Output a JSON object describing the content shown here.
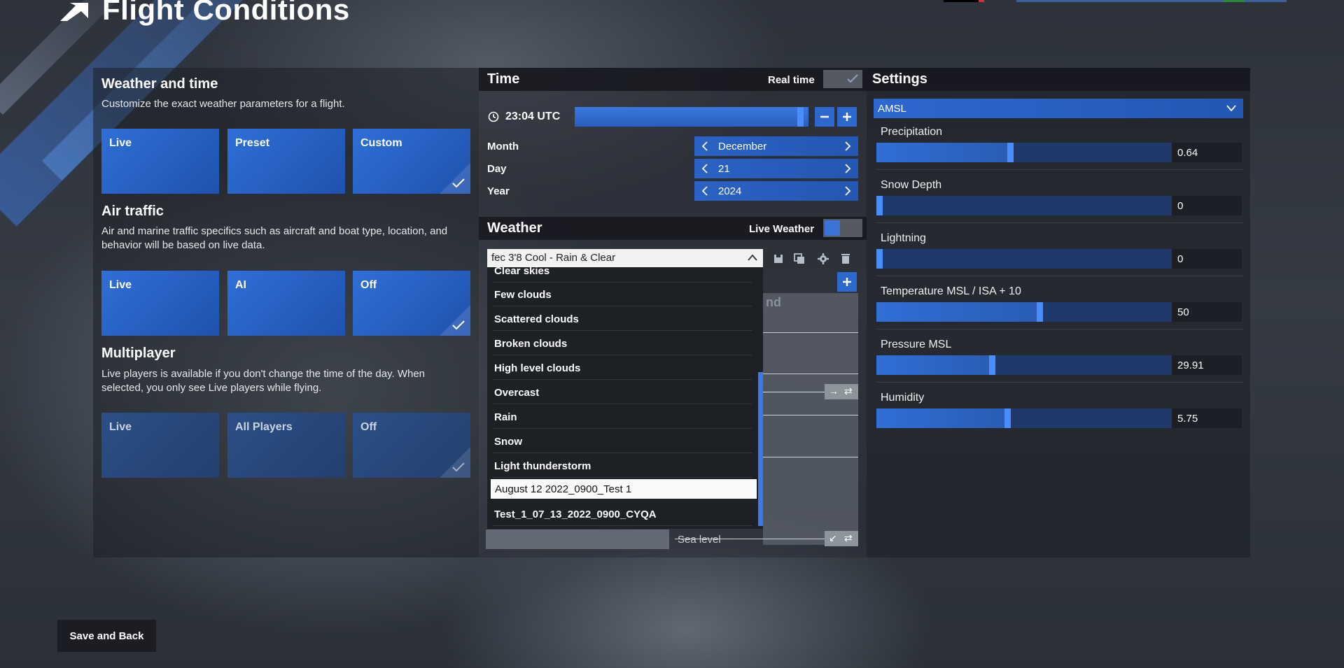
{
  "header": {
    "title": "Flight Conditions"
  },
  "weather_time": {
    "title": "Weather and time",
    "desc": "Customize the exact weather parameters for a flight.",
    "options": [
      {
        "label": "Live",
        "selected": false
      },
      {
        "label": "Preset",
        "selected": false
      },
      {
        "label": "Custom",
        "selected": true
      }
    ]
  },
  "air_traffic": {
    "title": "Air traffic",
    "desc": "Air and marine traffic specifics such as aircraft and boat type, location, and behavior will be based on live data.",
    "options": [
      {
        "label": "Live",
        "selected": false
      },
      {
        "label": "AI",
        "selected": false
      },
      {
        "label": "Off",
        "selected": true
      }
    ]
  },
  "multiplayer": {
    "title": "Multiplayer",
    "desc": "Live players is available if you don't change the time of the day. When selected, you only see Live players while flying.",
    "options": [
      {
        "label": "Live",
        "selected": false
      },
      {
        "label": "All Players",
        "selected": false
      },
      {
        "label": "Off",
        "selected": true
      }
    ]
  },
  "time": {
    "title": "Time",
    "real_time_label": "Real time",
    "utc": "23:04 UTC",
    "rows": [
      {
        "label": "Month",
        "value": "December"
      },
      {
        "label": "Day",
        "value": "21"
      },
      {
        "label": "Year",
        "value": "2024"
      }
    ]
  },
  "weather": {
    "title": "Weather",
    "live_weather_label": "Live Weather",
    "preset_value": "fec 3'8 Cool - Rain & Clear",
    "behind_text": "nd",
    "sea_level": "Sea level",
    "presets": [
      "Clear skies",
      "Few clouds",
      "Scattered clouds",
      "Broken clouds",
      "High level clouds",
      "Overcast",
      "Rain",
      "Snow",
      "Light thunderstorm",
      "August 12 2022_0900_Test 1",
      "Test_1_07_13_2022_0900_CYQA"
    ],
    "selected_preset": "August 12 2022_0900_Test 1"
  },
  "settings": {
    "title": "Settings",
    "altitude_mode": "AMSL",
    "items": [
      {
        "label": "Precipitation",
        "value": "0.64",
        "fraction": 0.45
      },
      {
        "label": "Snow Depth",
        "value": "0",
        "fraction": 0.0
      },
      {
        "label": "Lightning",
        "value": "0",
        "fraction": 0.0
      },
      {
        "label": "Temperature MSL / ISA + 10",
        "value": "50",
        "fraction": 0.55
      },
      {
        "label": "Pressure MSL",
        "value": "29.91",
        "fraction": 0.39
      },
      {
        "label": "Humidity",
        "value": "5.75",
        "fraction": 0.44
      }
    ]
  },
  "footer": {
    "save_back": "Save and Back"
  },
  "colors": {
    "accent": "#2d68cf",
    "accent_bright": "#4a8dff",
    "panel": "#1c1f25"
  }
}
